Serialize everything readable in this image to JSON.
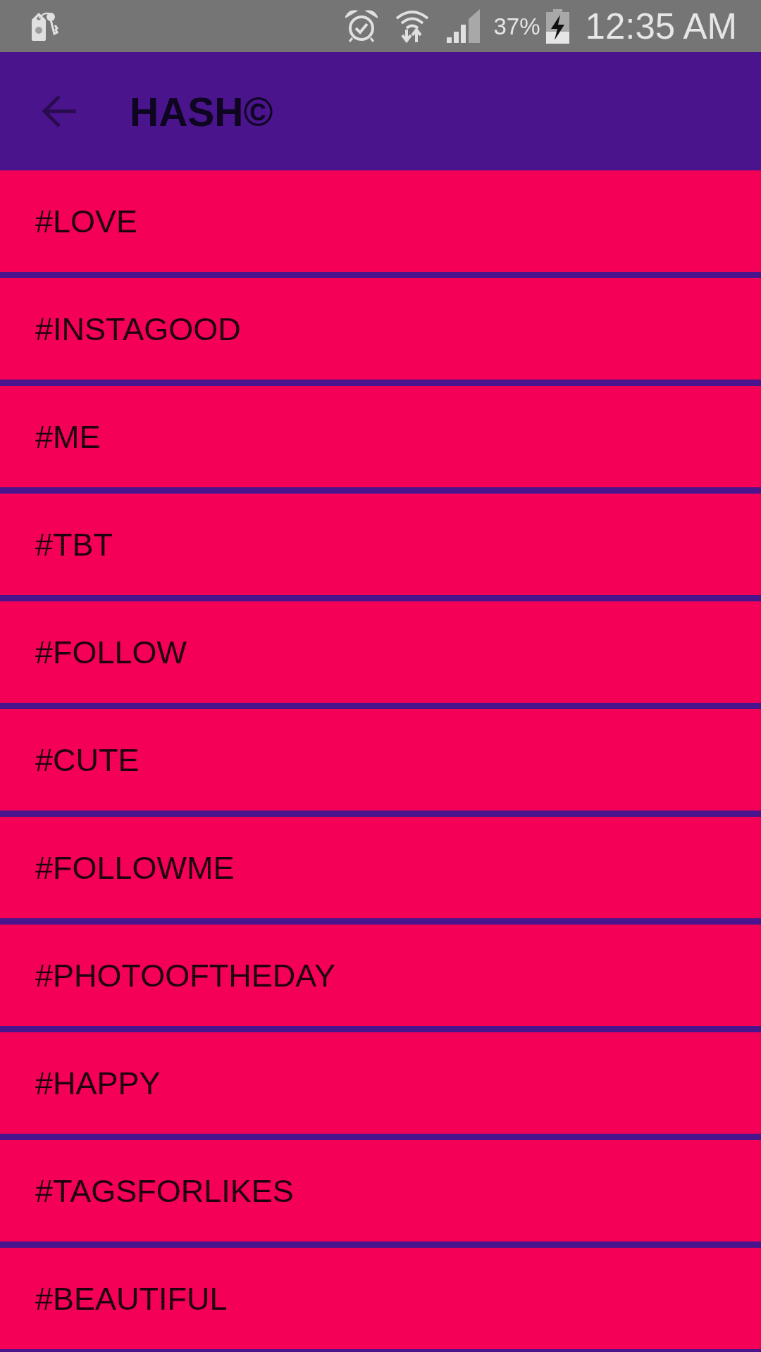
{
  "status_bar": {
    "battery_percent": "37%",
    "time": "12:35 AM"
  },
  "app_bar": {
    "title": "HASH©"
  },
  "hashtags": [
    {
      "label": "#LOVE"
    },
    {
      "label": "#INSTAGOOD"
    },
    {
      "label": "#ME"
    },
    {
      "label": "#TBT"
    },
    {
      "label": "#FOLLOW"
    },
    {
      "label": "#CUTE"
    },
    {
      "label": "#FOLLOWME"
    },
    {
      "label": "#PHOTOOFTHEDAY"
    },
    {
      "label": "#HAPPY"
    },
    {
      "label": "#TAGSFORLIKES"
    },
    {
      "label": "#BEAUTIFUL"
    }
  ]
}
